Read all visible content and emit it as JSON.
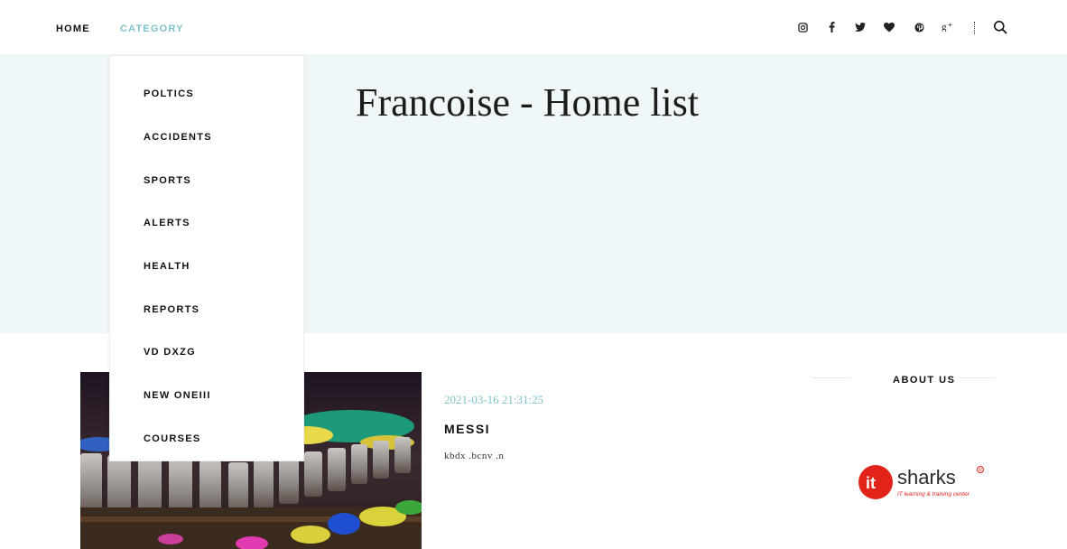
{
  "nav": {
    "home_label": "HOME",
    "category_label": "CATEGORY"
  },
  "social_icons": [
    "instagram-icon",
    "facebook-icon",
    "twitter-icon",
    "heart-icon",
    "pinterest-icon",
    "google-plus-icon"
  ],
  "search_icon": "search-icon",
  "hero": {
    "title": "Francoise - Home list"
  },
  "category_menu": {
    "items": [
      "POLTICS",
      "ACCIDENTS",
      "SPORTS",
      "ALERTS",
      "HEALTH",
      "REPORTS",
      "VD DXZG",
      "NEW ONEIII",
      "COURSES"
    ]
  },
  "post": {
    "date": "2021-03-16 21:31:25",
    "title": "MESSI",
    "excerpt": "kbdx .bcnv .n"
  },
  "sidebar": {
    "about_title": "ABOUT US",
    "logo_text": "it sharks",
    "logo_tagline": "IT learning & training center"
  },
  "colors": {
    "accent": "#7ec3cc",
    "hero_bg": "#f0f7f8",
    "logo_red": "#e2231a"
  }
}
